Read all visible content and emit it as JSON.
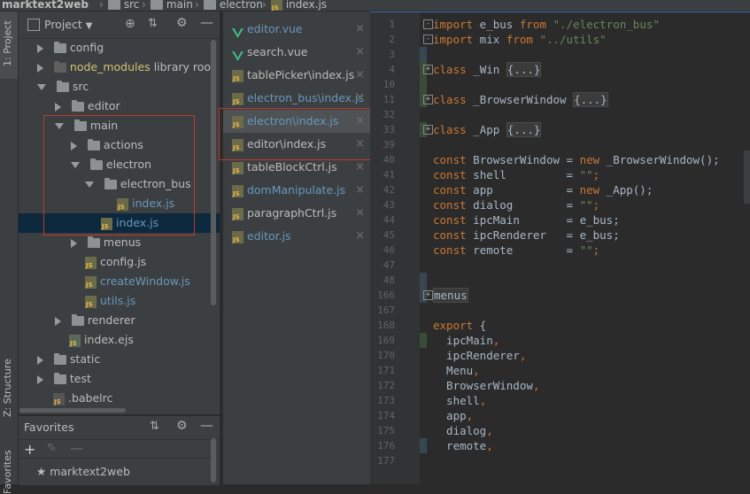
{
  "breadcrumb": {
    "items": [
      "marktext2web",
      "src",
      "main",
      "electron",
      "index.js"
    ]
  },
  "left_stripe": {
    "tab_project": "1: Project",
    "tab_structure": "Z: Structure",
    "tab_favorites": "Favorites"
  },
  "project_panel": {
    "title": "Project",
    "tree": [
      {
        "label": "config"
      },
      {
        "label": "node_modules",
        "suffix": "library root"
      },
      {
        "label": "src"
      },
      {
        "label": "editor"
      },
      {
        "label": "main"
      },
      {
        "label": "actions"
      },
      {
        "label": "electron"
      },
      {
        "label": "electron_bus"
      },
      {
        "label": "index.js"
      },
      {
        "label": "index.js"
      },
      {
        "label": "menus"
      },
      {
        "label": "config.js"
      },
      {
        "label": "createWindow.js"
      },
      {
        "label": "utils.js"
      },
      {
        "label": "renderer"
      },
      {
        "label": "index.ejs"
      },
      {
        "label": "static"
      },
      {
        "label": "test"
      },
      {
        "label": ".babelrc"
      }
    ]
  },
  "favorites": {
    "title": "Favorites",
    "items": [
      {
        "label": "marktext2web"
      }
    ]
  },
  "open_tabs": [
    {
      "label": "editor.vue",
      "icon": "vue-icon"
    },
    {
      "label": "search.vue",
      "icon": "vue-icon"
    },
    {
      "label": "tablePicker\\index.js",
      "icon": "js-icon"
    },
    {
      "label": "electron_bus\\index.js",
      "icon": "js-icon"
    },
    {
      "label": "electron\\index.js",
      "icon": "js-icon"
    },
    {
      "label": "editor\\index.js",
      "icon": "js-icon"
    },
    {
      "label": "tableBlockCtrl.js",
      "icon": "js-icon"
    },
    {
      "label": "domManipulate.js",
      "icon": "js-icon"
    },
    {
      "label": "paragraphCtrl.js",
      "icon": "js-icon"
    },
    {
      "label": "editor.js",
      "icon": "js-icon"
    }
  ],
  "editor": {
    "line_numbers": [
      "1",
      "2",
      "3",
      "4",
      "10",
      "11",
      "32",
      "33",
      "39",
      "40",
      "41",
      "42",
      "43",
      "44",
      "45",
      "46",
      "47",
      "48",
      "166",
      "167",
      "168",
      "169",
      "170",
      "171",
      "172",
      "173",
      "174",
      "175",
      "176",
      "177"
    ],
    "lines": [
      [
        {
          "t": "import",
          "c": "kw"
        },
        {
          "t": " e_bus ",
          "c": "id"
        },
        {
          "t": "from",
          "c": "kw"
        },
        {
          "t": " ",
          "c": "id"
        },
        {
          "t": "\"./electron_bus\"",
          "c": "str"
        }
      ],
      [
        {
          "t": "import",
          "c": "kw"
        },
        {
          "t": " mix ",
          "c": "id"
        },
        {
          "t": "from",
          "c": "kw"
        },
        {
          "t": " ",
          "c": "id"
        },
        {
          "t": "\"../utils\"",
          "c": "str"
        }
      ],
      [],
      [
        {
          "t": "class",
          "c": "kw"
        },
        {
          "t": " _Win ",
          "c": "id"
        },
        {
          "t": "{...}",
          "c": "fold"
        }
      ],
      [],
      [
        {
          "t": "class",
          "c": "kw"
        },
        {
          "t": " _BrowserWindow ",
          "c": "id"
        },
        {
          "t": "{...}",
          "c": "fold"
        }
      ],
      [],
      [
        {
          "t": "class",
          "c": "kw"
        },
        {
          "t": " _App ",
          "c": "id"
        },
        {
          "t": "{...}",
          "c": "fold"
        }
      ],
      [],
      [
        {
          "t": "const",
          "c": "kw"
        },
        {
          "t": " BrowserWindow = ",
          "c": "id"
        },
        {
          "t": "new",
          "c": "kw"
        },
        {
          "t": " _BrowserWindow();",
          "c": "id"
        }
      ],
      [
        {
          "t": "const",
          "c": "kw"
        },
        {
          "t": " shell         = ",
          "c": "id"
        },
        {
          "t": "\"\"",
          "c": "str"
        },
        {
          "t": ";",
          "c": "kw"
        }
      ],
      [
        {
          "t": "const",
          "c": "kw"
        },
        {
          "t": " app           = ",
          "c": "id"
        },
        {
          "t": "new",
          "c": "kw"
        },
        {
          "t": " _App();",
          "c": "id"
        }
      ],
      [
        {
          "t": "const",
          "c": "kw"
        },
        {
          "t": " dialog        = ",
          "c": "id"
        },
        {
          "t": "\"\"",
          "c": "str"
        },
        {
          "t": ";",
          "c": "kw"
        }
      ],
      [
        {
          "t": "const",
          "c": "kw"
        },
        {
          "t": " ipcMain       = e_bus;",
          "c": "id"
        }
      ],
      [
        {
          "t": "const",
          "c": "kw"
        },
        {
          "t": " ipcRenderer   = e_bus;",
          "c": "id"
        }
      ],
      [
        {
          "t": "const",
          "c": "kw"
        },
        {
          "t": " remote        = ",
          "c": "id"
        },
        {
          "t": "\"\"",
          "c": "str"
        },
        {
          "t": ";",
          "c": "kw"
        }
      ],
      [],
      [],
      [
        {
          "t": "menus",
          "c": "fold"
        }
      ],
      [],
      [
        {
          "t": "export",
          "c": "kw"
        },
        {
          "t": " {",
          "c": "id"
        }
      ],
      [
        {
          "t": "  ipcMain",
          "c": "id"
        },
        {
          "t": ",",
          "c": "kw"
        }
      ],
      [
        {
          "t": "  ipcRenderer",
          "c": "id"
        },
        {
          "t": ",",
          "c": "kw"
        }
      ],
      [
        {
          "t": "  Menu",
          "c": "id"
        },
        {
          "t": ",",
          "c": "kw"
        }
      ],
      [
        {
          "t": "  BrowserWindow",
          "c": "id"
        },
        {
          "t": ",",
          "c": "kw"
        }
      ],
      [
        {
          "t": "  shell",
          "c": "id"
        },
        {
          "t": ",",
          "c": "kw"
        }
      ],
      [
        {
          "t": "  app",
          "c": "id"
        },
        {
          "t": ",",
          "c": "kw"
        }
      ],
      [
        {
          "t": "  dialog",
          "c": "id"
        },
        {
          "t": ",",
          "c": "kw"
        }
      ],
      [
        {
          "t": "  remote",
          "c": "id"
        },
        {
          "t": ",",
          "c": "kw"
        }
      ],
      []
    ]
  },
  "colors": {
    "keyword": "#cc7832",
    "string": "#6a8759",
    "identifier": "#a9b7c6",
    "selection": "#0d293e",
    "highlight_box": "#c0392b",
    "vue_green": "#41b883",
    "lib_folder_text": "#d3c272"
  }
}
